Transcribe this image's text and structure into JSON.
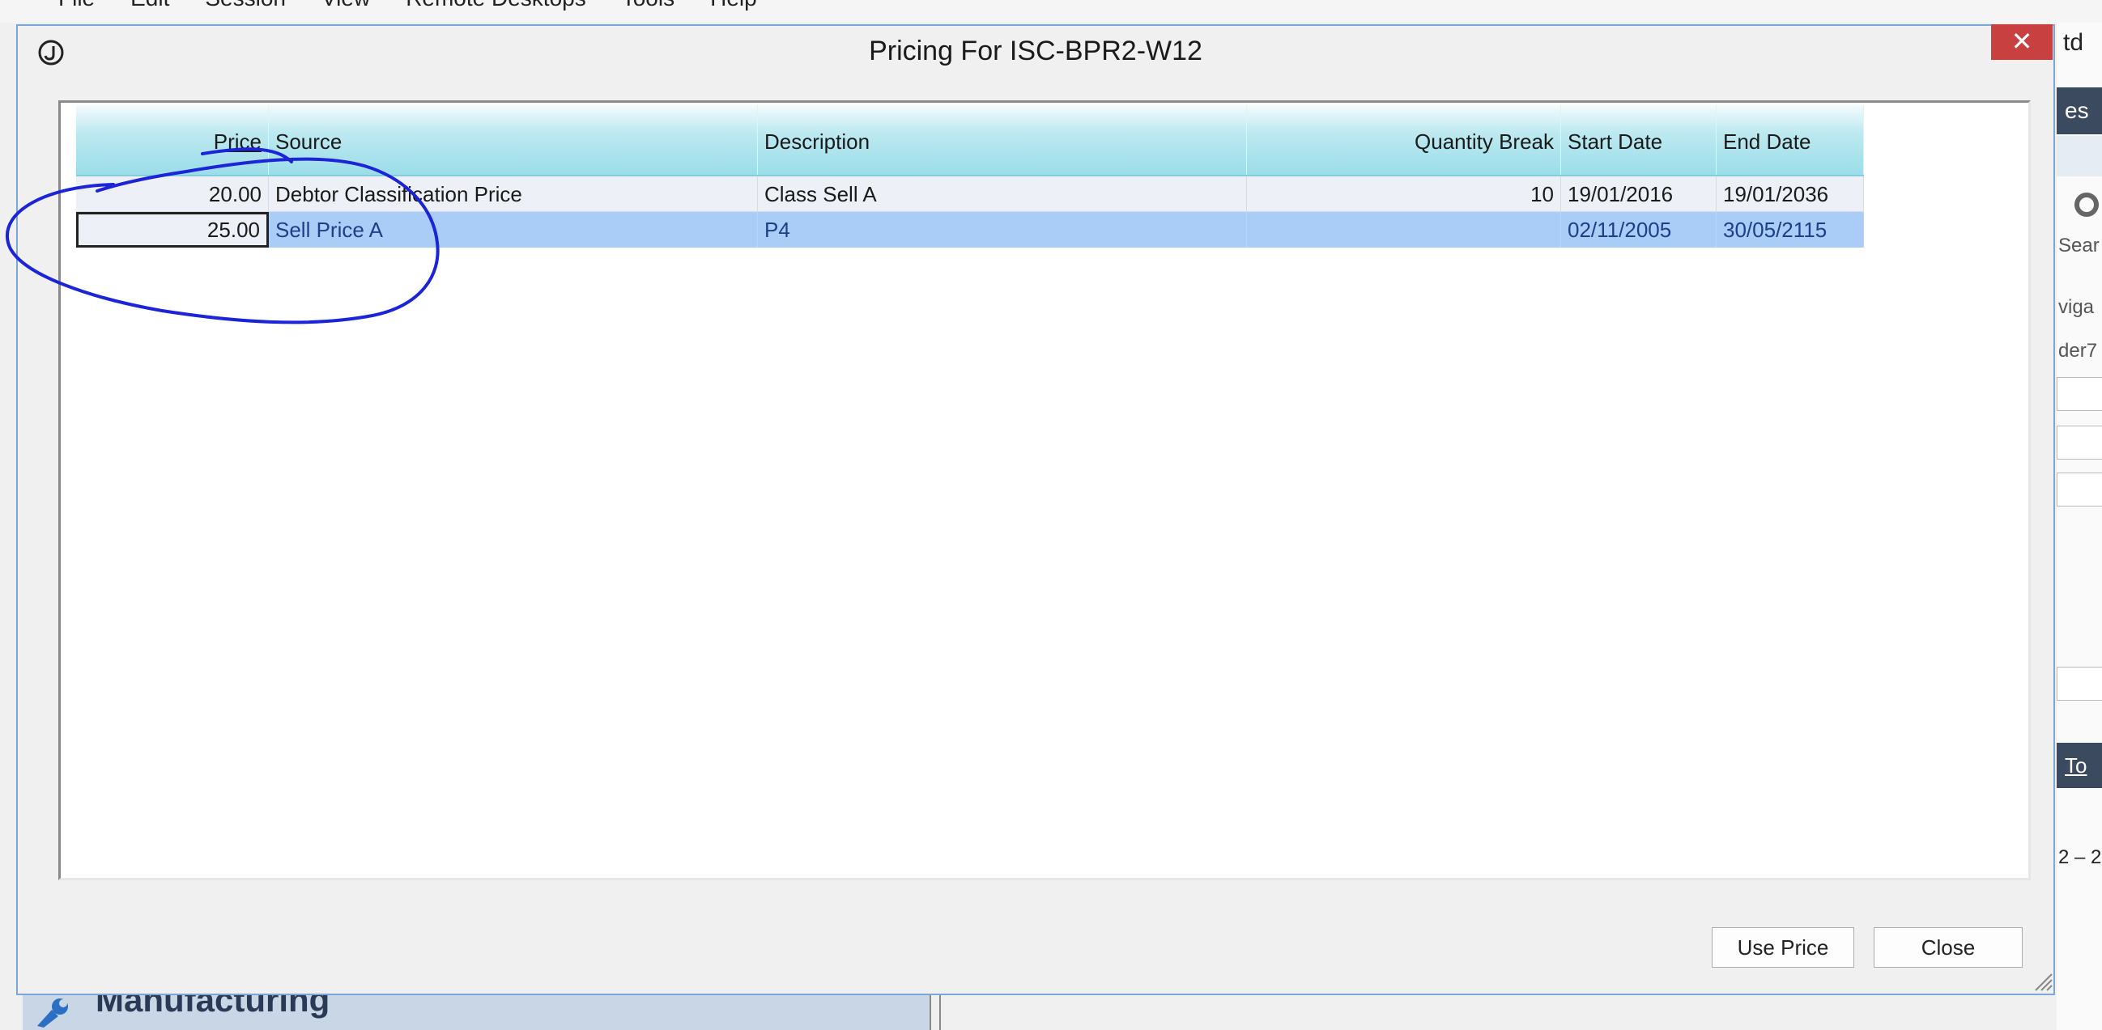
{
  "menubar": {
    "items": [
      "File",
      "Edit",
      "Session",
      "View",
      "Remote Desktops",
      "Tools",
      "Help"
    ]
  },
  "background_app": {
    "title_fragment": "td",
    "tab_fragment": "es",
    "text_1": "Sear",
    "text_2": "viga",
    "text_3": "der7",
    "tab2_fragment": "To",
    "text_4": "2 – 2",
    "bottom_panel_label": "Manufacturing"
  },
  "dialog": {
    "title": "Pricing For ISC-BPR2-W12",
    "close_glyph": "✕"
  },
  "grid": {
    "headers": {
      "price": "Price",
      "source": "Source",
      "description": "Description",
      "quantity_break": "Quantity Break",
      "start_date": "Start Date",
      "end_date": "End Date"
    },
    "rows": [
      {
        "price": "20.00",
        "source": "Debtor Classification Price",
        "description": "Class Sell A",
        "quantity_break": "10",
        "start_date": "19/01/2016",
        "end_date": "19/01/2036"
      },
      {
        "price": "25.00",
        "source": "Sell Price A",
        "description": "P4",
        "quantity_break": "",
        "start_date": "02/11/2005",
        "end_date": "30/05/2115"
      }
    ]
  },
  "buttons": {
    "use_price": "Use Price",
    "close": "Close"
  },
  "colors": {
    "header_gradient_end": "#9bdde9",
    "selected_row": "#a9cdf6",
    "close_button": "#c84040",
    "annotation_ink": "#1c24d8"
  },
  "icons": {
    "app_icon": "circled-j-icon",
    "close_icon": "close-icon",
    "resize_grip": "resize-grip-icon"
  }
}
